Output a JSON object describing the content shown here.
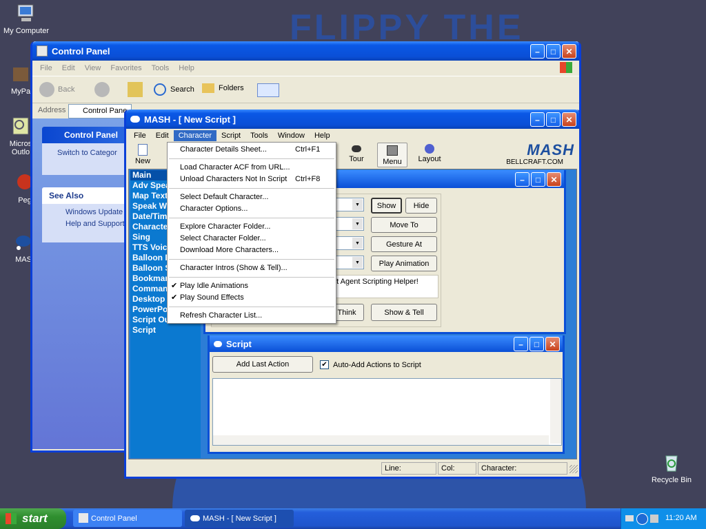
{
  "desktop": {
    "icons": [
      {
        "label": "My Computer"
      },
      {
        "label": "MyPa"
      },
      {
        "label": "Micros Outlo"
      },
      {
        "label": "Peg"
      },
      {
        "label": "MAS"
      },
      {
        "label": "Recycle Bin"
      }
    ],
    "wallpaper_text": "FLIPPY THE"
  },
  "control_panel": {
    "title": "Control Panel",
    "menu": [
      "File",
      "Edit",
      "View",
      "Favorites",
      "Tools",
      "Help"
    ],
    "toolbar": {
      "back": "Back",
      "search": "Search",
      "folders": "Folders"
    },
    "address_label": "Address",
    "address_value": "Control Pane",
    "side_title": "Control Panel",
    "switch_link": "Switch to Categor",
    "see_also_title": "See Also",
    "see_also": [
      "Windows Update",
      "Help and Support"
    ]
  },
  "mash": {
    "title": "MASH - [ New Script ]",
    "menu": [
      "File",
      "Edit",
      "Character",
      "Script",
      "Tools",
      "Window",
      "Help"
    ],
    "toolbar": {
      "new": "New",
      "tour": "Tour",
      "menu": "Menu",
      "layout": "Layout"
    },
    "logo": "MASH",
    "logo_sub": "BELLCRAFT.COM",
    "list": [
      "Main",
      "Adv Speak",
      "Map Text",
      "Speak W",
      "Date/Tim",
      "Characte",
      "Sing",
      "TTS Voice",
      "Balloon F",
      "Balloon S",
      "Bookmar",
      "Comman",
      "Desktop",
      "PowerPo",
      "Script Ou",
      "Script"
    ],
    "char_panel": {
      "buttons": {
        "show": "Show",
        "hide": "Hide",
        "move_to": "Move To",
        "gesture_at": "Gesture At",
        "play_animation": "Play Animation",
        "think": "Think",
        "show_tell": "Show & Tell"
      },
      "text": "oft Agent Scripting Helper!"
    },
    "script_panel": {
      "title": "Script",
      "add_last_action": "Add Last Action",
      "auto_add": "Auto-Add Actions to Script"
    },
    "status": {
      "line": "Line:",
      "col": "Col:",
      "character": "Character:"
    }
  },
  "character_menu": {
    "items": [
      {
        "label": "Character Details Sheet...",
        "shortcut": "Ctrl+F1"
      },
      {
        "label": "Load Character ACF from URL...",
        "shortcut": ""
      },
      {
        "label": "Unload Characters Not In Script",
        "shortcut": "Ctrl+F8"
      },
      {
        "label": "Select Default Character...",
        "shortcut": ""
      },
      {
        "label": "Character Options...",
        "shortcut": ""
      },
      {
        "label": "Explore Character Folder...",
        "shortcut": ""
      },
      {
        "label": "Select Character Folder...",
        "shortcut": ""
      },
      {
        "label": "Download More Characters...",
        "shortcut": ""
      },
      {
        "label": "Character Intros (Show & Tell)...",
        "shortcut": ""
      },
      {
        "label": "Play Idle Animations",
        "shortcut": "",
        "checked": true
      },
      {
        "label": "Play Sound Effects",
        "shortcut": "",
        "checked": true
      },
      {
        "label": "Refresh Character List...",
        "shortcut": ""
      }
    ]
  },
  "taskbar": {
    "start": "start",
    "tasks": [
      "Control Panel",
      "MASH - [ New Script ]"
    ],
    "clock": "11:20 AM"
  },
  "colors": {
    "xp_blue": "#0a4fd6",
    "list_bg": "#0b79d0",
    "desktop": "#41425a"
  }
}
